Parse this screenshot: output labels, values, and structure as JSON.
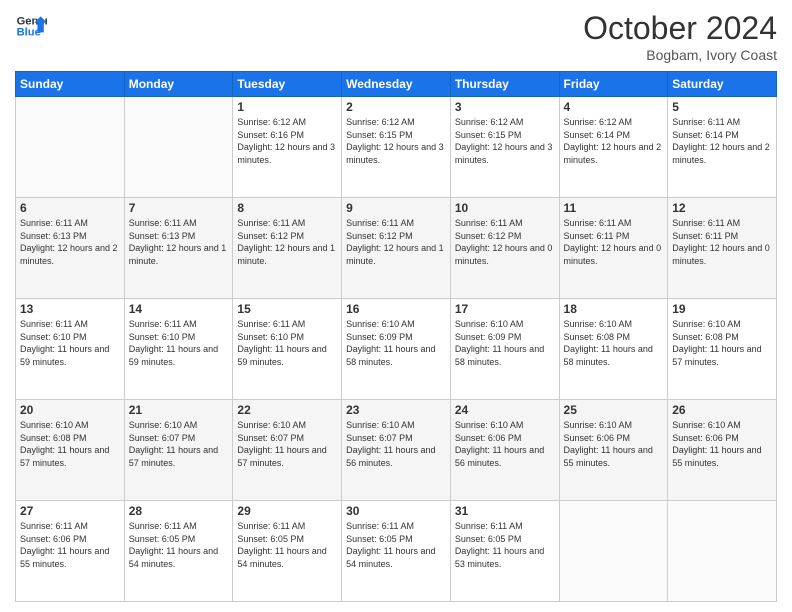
{
  "header": {
    "logo_line1": "General",
    "logo_line2": "Blue",
    "month": "October 2024",
    "location": "Bogbam, Ivory Coast"
  },
  "days_of_week": [
    "Sunday",
    "Monday",
    "Tuesday",
    "Wednesday",
    "Thursday",
    "Friday",
    "Saturday"
  ],
  "weeks": [
    [
      {
        "day": "",
        "content": ""
      },
      {
        "day": "",
        "content": ""
      },
      {
        "day": "1",
        "content": "Sunrise: 6:12 AM\nSunset: 6:16 PM\nDaylight: 12 hours and 3 minutes."
      },
      {
        "day": "2",
        "content": "Sunrise: 6:12 AM\nSunset: 6:15 PM\nDaylight: 12 hours and 3 minutes."
      },
      {
        "day": "3",
        "content": "Sunrise: 6:12 AM\nSunset: 6:15 PM\nDaylight: 12 hours and 3 minutes."
      },
      {
        "day": "4",
        "content": "Sunrise: 6:12 AM\nSunset: 6:14 PM\nDaylight: 12 hours and 2 minutes."
      },
      {
        "day": "5",
        "content": "Sunrise: 6:11 AM\nSunset: 6:14 PM\nDaylight: 12 hours and 2 minutes."
      }
    ],
    [
      {
        "day": "6",
        "content": "Sunrise: 6:11 AM\nSunset: 6:13 PM\nDaylight: 12 hours and 2 minutes."
      },
      {
        "day": "7",
        "content": "Sunrise: 6:11 AM\nSunset: 6:13 PM\nDaylight: 12 hours and 1 minute."
      },
      {
        "day": "8",
        "content": "Sunrise: 6:11 AM\nSunset: 6:12 PM\nDaylight: 12 hours and 1 minute."
      },
      {
        "day": "9",
        "content": "Sunrise: 6:11 AM\nSunset: 6:12 PM\nDaylight: 12 hours and 1 minute."
      },
      {
        "day": "10",
        "content": "Sunrise: 6:11 AM\nSunset: 6:12 PM\nDaylight: 12 hours and 0 minutes."
      },
      {
        "day": "11",
        "content": "Sunrise: 6:11 AM\nSunset: 6:11 PM\nDaylight: 12 hours and 0 minutes."
      },
      {
        "day": "12",
        "content": "Sunrise: 6:11 AM\nSunset: 6:11 PM\nDaylight: 12 hours and 0 minutes."
      }
    ],
    [
      {
        "day": "13",
        "content": "Sunrise: 6:11 AM\nSunset: 6:10 PM\nDaylight: 11 hours and 59 minutes."
      },
      {
        "day": "14",
        "content": "Sunrise: 6:11 AM\nSunset: 6:10 PM\nDaylight: 11 hours and 59 minutes."
      },
      {
        "day": "15",
        "content": "Sunrise: 6:11 AM\nSunset: 6:10 PM\nDaylight: 11 hours and 59 minutes."
      },
      {
        "day": "16",
        "content": "Sunrise: 6:10 AM\nSunset: 6:09 PM\nDaylight: 11 hours and 58 minutes."
      },
      {
        "day": "17",
        "content": "Sunrise: 6:10 AM\nSunset: 6:09 PM\nDaylight: 11 hours and 58 minutes."
      },
      {
        "day": "18",
        "content": "Sunrise: 6:10 AM\nSunset: 6:08 PM\nDaylight: 11 hours and 58 minutes."
      },
      {
        "day": "19",
        "content": "Sunrise: 6:10 AM\nSunset: 6:08 PM\nDaylight: 11 hours and 57 minutes."
      }
    ],
    [
      {
        "day": "20",
        "content": "Sunrise: 6:10 AM\nSunset: 6:08 PM\nDaylight: 11 hours and 57 minutes."
      },
      {
        "day": "21",
        "content": "Sunrise: 6:10 AM\nSunset: 6:07 PM\nDaylight: 11 hours and 57 minutes."
      },
      {
        "day": "22",
        "content": "Sunrise: 6:10 AM\nSunset: 6:07 PM\nDaylight: 11 hours and 57 minutes."
      },
      {
        "day": "23",
        "content": "Sunrise: 6:10 AM\nSunset: 6:07 PM\nDaylight: 11 hours and 56 minutes."
      },
      {
        "day": "24",
        "content": "Sunrise: 6:10 AM\nSunset: 6:06 PM\nDaylight: 11 hours and 56 minutes."
      },
      {
        "day": "25",
        "content": "Sunrise: 6:10 AM\nSunset: 6:06 PM\nDaylight: 11 hours and 55 minutes."
      },
      {
        "day": "26",
        "content": "Sunrise: 6:10 AM\nSunset: 6:06 PM\nDaylight: 11 hours and 55 minutes."
      }
    ],
    [
      {
        "day": "27",
        "content": "Sunrise: 6:11 AM\nSunset: 6:06 PM\nDaylight: 11 hours and 55 minutes."
      },
      {
        "day": "28",
        "content": "Sunrise: 6:11 AM\nSunset: 6:05 PM\nDaylight: 11 hours and 54 minutes."
      },
      {
        "day": "29",
        "content": "Sunrise: 6:11 AM\nSunset: 6:05 PM\nDaylight: 11 hours and 54 minutes."
      },
      {
        "day": "30",
        "content": "Sunrise: 6:11 AM\nSunset: 6:05 PM\nDaylight: 11 hours and 54 minutes."
      },
      {
        "day": "31",
        "content": "Sunrise: 6:11 AM\nSunset: 6:05 PM\nDaylight: 11 hours and 53 minutes."
      },
      {
        "day": "",
        "content": ""
      },
      {
        "day": "",
        "content": ""
      }
    ]
  ]
}
